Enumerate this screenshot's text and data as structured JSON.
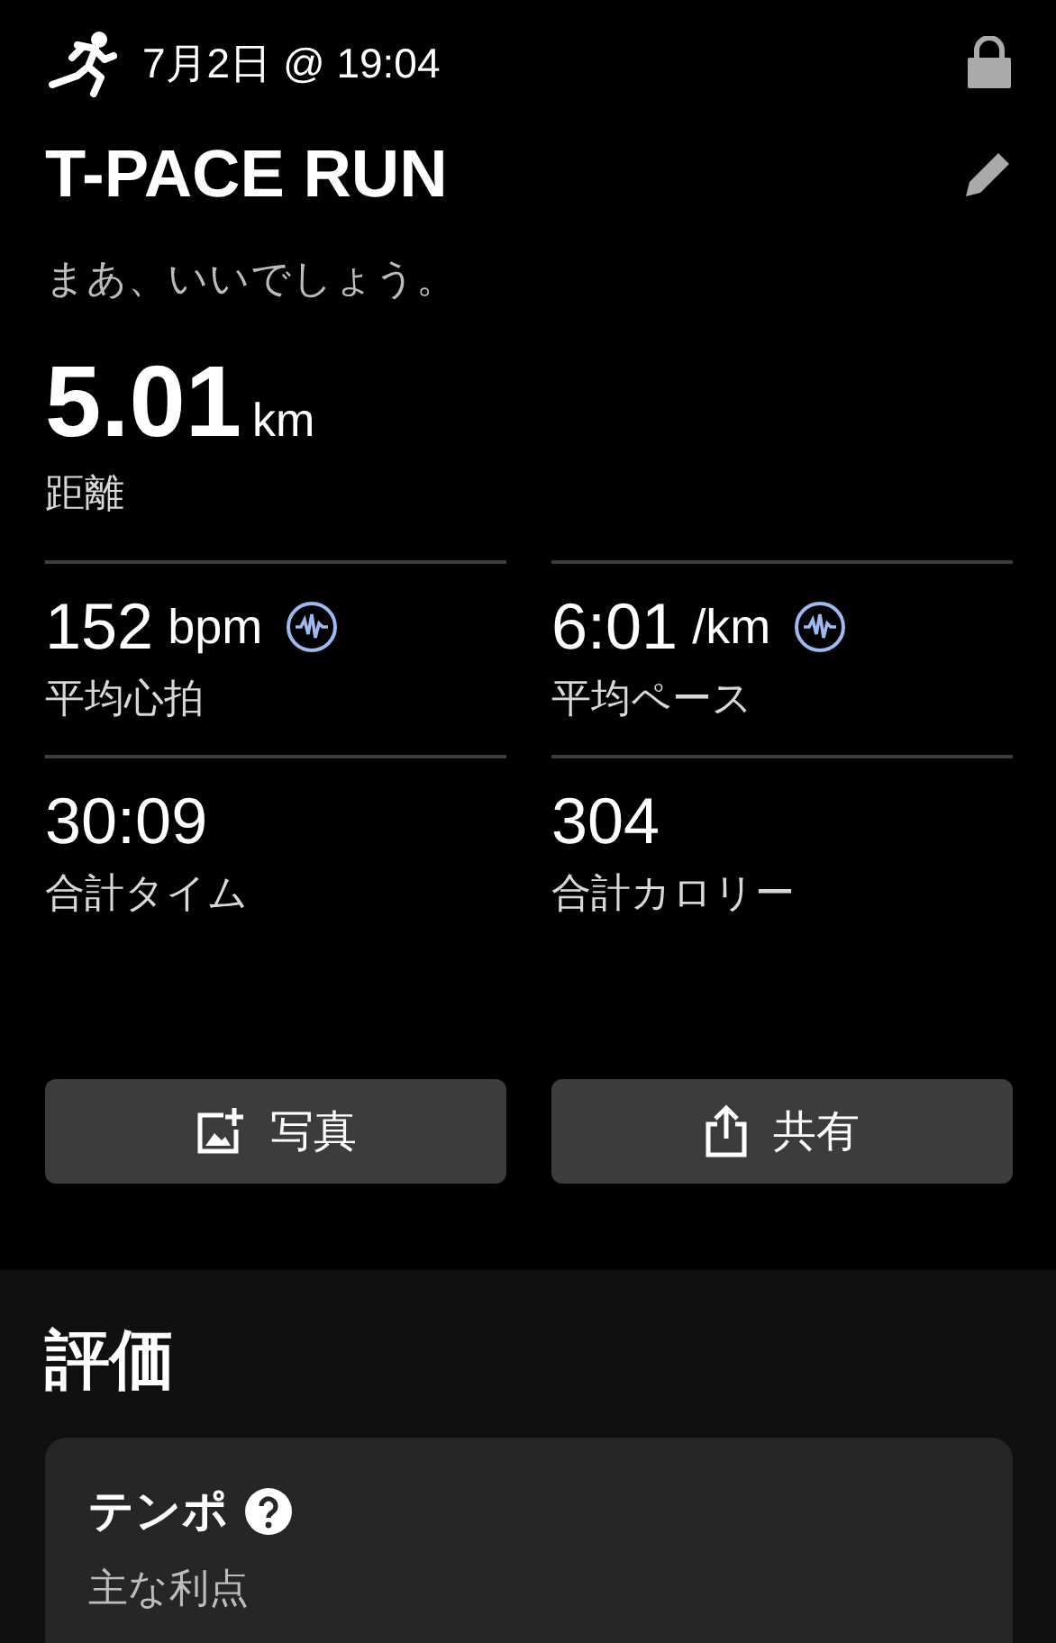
{
  "header": {
    "date": "7月2日 @ 19:04",
    "locked": true
  },
  "title": "T-PACE RUN",
  "comment": "まあ、いいでしょう。",
  "distance": {
    "value": "5.01",
    "unit": "km",
    "label": "距離"
  },
  "stats": [
    {
      "value": "152",
      "unit": "bpm",
      "label": "平均心拍",
      "graph_link": true
    },
    {
      "value": "6:01",
      "unit": "/km",
      "label": "平均ペース",
      "graph_link": true
    },
    {
      "value": "30:09",
      "label": "合計タイム",
      "graph_link": false
    },
    {
      "value": "304",
      "label": "合計カロリー",
      "graph_link": false
    }
  ],
  "actions": [
    {
      "kind": "photo",
      "label": "写真"
    },
    {
      "kind": "share",
      "label": "共有"
    }
  ],
  "evaluation": {
    "heading": "評価",
    "card": {
      "title": "テンポ",
      "subtitle": "主な利点"
    }
  }
}
